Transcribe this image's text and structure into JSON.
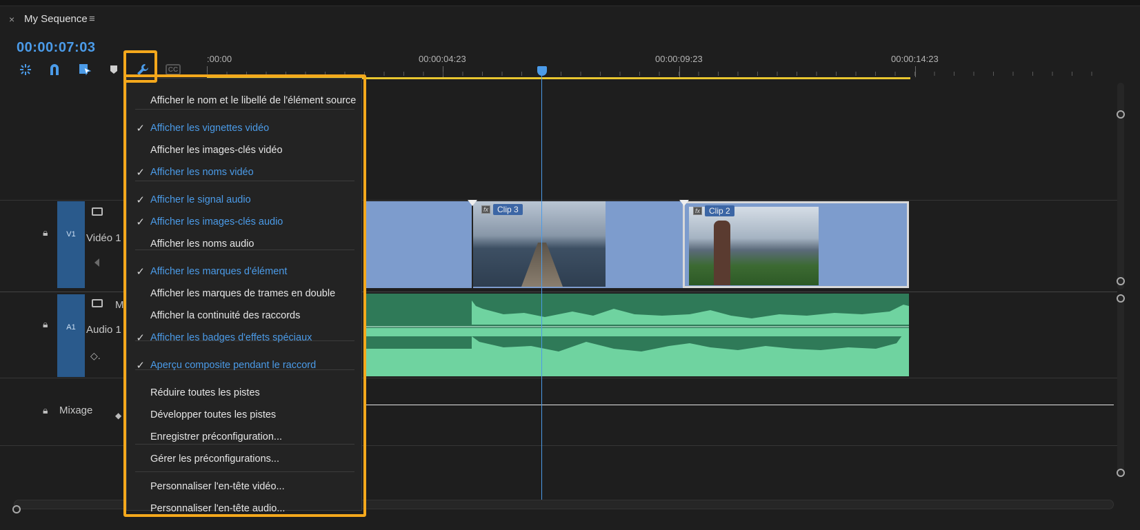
{
  "panel": {
    "close_glyph": "×",
    "title": "My Sequence",
    "menu_glyph": "≡"
  },
  "timecode": "00:00:07:03",
  "toolbar": {
    "icons": [
      "nest-icon",
      "snap-magnet-icon",
      "linked-selection-icon",
      "add-marker-icon",
      "wrench-icon",
      "captions-icon"
    ],
    "cc_label": "CC"
  },
  "ruler": {
    "labels": [
      ":00:00",
      "00:00:04:23",
      "00:00:09:23",
      "00:00:14:23"
    ]
  },
  "tracks": {
    "v1": {
      "tag": "V1",
      "name": "Vidéo 1"
    },
    "a1": {
      "tag": "A1",
      "name": "Audio 1",
      "extra": "M"
    },
    "mix": {
      "name": "Mixage"
    }
  },
  "clips": [
    {
      "name": "Clip 3",
      "fx": "fx"
    },
    {
      "name": "Clip 2",
      "fx": "fx"
    }
  ],
  "menu": {
    "items": [
      {
        "label": "Afficher le nom et le libellé de l'élément source",
        "checked": false
      },
      {
        "label": "Afficher les vignettes vidéo",
        "checked": true
      },
      {
        "label": "Afficher les images-clés vidéo",
        "checked": false
      },
      {
        "label": "Afficher les noms vidéo",
        "checked": true
      },
      {
        "label": "Afficher le signal audio",
        "checked": true
      },
      {
        "label": "Afficher les images-clés audio",
        "checked": true
      },
      {
        "label": "Afficher les noms audio",
        "checked": false
      },
      {
        "label": "Afficher les marques d'élément",
        "checked": true
      },
      {
        "label": "Afficher les marques de trames en double",
        "checked": false
      },
      {
        "label": "Afficher la continuité des raccords",
        "checked": false
      },
      {
        "label": "Afficher les badges d'effets spéciaux",
        "checked": true
      },
      {
        "label": "Aperçu composite pendant le raccord",
        "checked": true
      },
      {
        "label": "Réduire toutes les pistes",
        "checked": false
      },
      {
        "label": "Développer toutes les pistes",
        "checked": false
      },
      {
        "label": "Enregistrer préconfiguration...",
        "checked": false
      },
      {
        "label": "Gérer les préconfigurations...",
        "checked": false
      },
      {
        "label": "Personnaliser l'en-tête vidéo...",
        "checked": false
      },
      {
        "label": "Personnaliser l'en-tête audio...",
        "checked": false
      }
    ],
    "check_glyph": "✓"
  },
  "colors": {
    "accent": "#4b9be8",
    "highlight": "#f4a81c",
    "audio": "#6fd3a0",
    "clip": "#7d9ccd"
  }
}
